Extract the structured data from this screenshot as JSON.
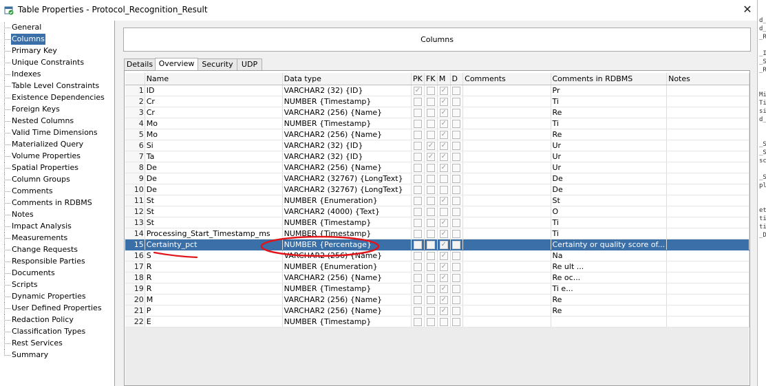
{
  "window": {
    "title": "Table Properties - Protocol_Recognition_Result",
    "close_glyph": "✕"
  },
  "nav": {
    "selected": "Columns",
    "items": [
      "General",
      "Columns",
      "Primary Key",
      "Unique Constraints",
      "Indexes",
      "Table Level Constraints",
      "Existence Dependencies",
      "Foreign Keys",
      "Nested Columns",
      "Valid Time Dimensions",
      "Materialized Query",
      "Volume Properties",
      "Spatial Properties",
      "Column Groups",
      "Comments",
      "Comments in RDBMS",
      "Notes",
      "Impact Analysis",
      "Measurements",
      "Change Requests",
      "Responsible Parties",
      "Documents",
      "Scripts",
      "Dynamic Properties",
      "User Defined Properties",
      "Redaction Policy",
      "Classification Types",
      "Rest Services",
      "Summary"
    ]
  },
  "section_title": "Columns",
  "tabs": [
    {
      "label": "Details",
      "active": false
    },
    {
      "label": "Overview",
      "active": true
    },
    {
      "label": "Security",
      "active": false
    },
    {
      "label": "UDP",
      "active": false
    }
  ],
  "grid": {
    "headers": {
      "name": "Name",
      "datatype": "Data type",
      "pk": "PK",
      "fk": "FK",
      "m": "M",
      "d": "D",
      "comments": "Comments",
      "comments_rdbms": "Comments in RDBMS",
      "notes": "Notes"
    },
    "selected_row": 15,
    "rows": [
      {
        "num": "1",
        "name": "ID",
        "datatype": "VARCHAR2 (32) {ID}",
        "pk": true,
        "fk": false,
        "m": true,
        "d": false,
        "comments": "",
        "rdbms": "Pr",
        "notes": ""
      },
      {
        "num": "2",
        "name": "Cr",
        "datatype": "NUMBER {Timestamp}",
        "pk": false,
        "fk": false,
        "m": true,
        "d": false,
        "comments": "",
        "rdbms": "Ti",
        "notes": ""
      },
      {
        "num": "3",
        "name": "Cr",
        "datatype": "VARCHAR2 (256) {Name}",
        "pk": false,
        "fk": false,
        "m": true,
        "d": false,
        "comments": "",
        "rdbms": "Re",
        "notes": ""
      },
      {
        "num": "4",
        "name": "Mo",
        "datatype": "NUMBER {Timestamp}",
        "pk": false,
        "fk": false,
        "m": true,
        "d": false,
        "comments": "",
        "rdbms": "Ti",
        "notes": ""
      },
      {
        "num": "5",
        "name": "Mo",
        "datatype": "VARCHAR2 (256) {Name}",
        "pk": false,
        "fk": false,
        "m": true,
        "d": false,
        "comments": "",
        "rdbms": "Re",
        "notes": ""
      },
      {
        "num": "6",
        "name": "Si",
        "datatype": "VARCHAR2 (32) {ID}",
        "pk": false,
        "fk": true,
        "m": true,
        "d": false,
        "comments": "",
        "rdbms": "Ur",
        "notes": ""
      },
      {
        "num": "7",
        "name": "Ta",
        "datatype": "VARCHAR2 (32) {ID}",
        "pk": false,
        "fk": true,
        "m": true,
        "d": false,
        "comments": "",
        "rdbms": "Ur",
        "notes": ""
      },
      {
        "num": "8",
        "name": "De",
        "datatype": "VARCHAR2 (256) {Name}",
        "pk": false,
        "fk": false,
        "m": true,
        "d": false,
        "comments": "",
        "rdbms": "Ur",
        "notes": ""
      },
      {
        "num": "9",
        "name": "De",
        "datatype": "VARCHAR2 (32767) {LongText}",
        "pk": false,
        "fk": false,
        "m": false,
        "d": false,
        "comments": "",
        "rdbms": "De",
        "notes": ""
      },
      {
        "num": "10",
        "name": "De",
        "datatype": "VARCHAR2 (32767) {LongText}",
        "pk": false,
        "fk": false,
        "m": false,
        "d": false,
        "comments": "",
        "rdbms": "De",
        "notes": ""
      },
      {
        "num": "11",
        "name": "St",
        "datatype": "NUMBER {Enumeration}",
        "pk": false,
        "fk": false,
        "m": true,
        "d": false,
        "comments": "",
        "rdbms": "St",
        "notes": ""
      },
      {
        "num": "12",
        "name": "St",
        "datatype": "VARCHAR2 (4000) {Text}",
        "pk": false,
        "fk": false,
        "m": false,
        "d": false,
        "comments": "",
        "rdbms": "O",
        "notes": ""
      },
      {
        "num": "13",
        "name": "St",
        "datatype": "NUMBER {Timestamp}",
        "pk": false,
        "fk": false,
        "m": true,
        "d": false,
        "comments": "",
        "rdbms": "Ti",
        "notes": ""
      },
      {
        "num": "14",
        "name": "Processing_Start_Timestamp_ms",
        "datatype": "NUMBER {Timestamp}",
        "pk": false,
        "fk": false,
        "m": true,
        "d": false,
        "comments": "",
        "rdbms": "Ti",
        "notes": ""
      },
      {
        "num": "15",
        "name": "Certainty_pct",
        "datatype": "NUMBER {Percentage}",
        "pk": false,
        "fk": false,
        "m": true,
        "d": false,
        "comments": "",
        "rdbms": "Certainty or quality score of...",
        "notes": ""
      },
      {
        "num": "16",
        "name": "S",
        "datatype": "VARCHAR2 (256) {Name}",
        "pk": false,
        "fk": false,
        "m": true,
        "d": false,
        "comments": "",
        "rdbms": "Na",
        "notes": ""
      },
      {
        "num": "17",
        "name": "R",
        "datatype": "NUMBER {Enumeration}",
        "pk": false,
        "fk": false,
        "m": true,
        "d": false,
        "comments": "",
        "rdbms": "Re                    ult ...",
        "notes": ""
      },
      {
        "num": "18",
        "name": "R",
        "datatype": "VARCHAR2 (256) {Name}",
        "pk": false,
        "fk": false,
        "m": true,
        "d": false,
        "comments": "",
        "rdbms": "Re                    oc...",
        "notes": ""
      },
      {
        "num": "19",
        "name": "R",
        "datatype": "NUMBER {Timestamp}",
        "pk": false,
        "fk": false,
        "m": true,
        "d": false,
        "comments": "",
        "rdbms": "Ti                     e...",
        "notes": ""
      },
      {
        "num": "20",
        "name": "M",
        "datatype": "VARCHAR2 (256) {Name}",
        "pk": false,
        "fk": false,
        "m": true,
        "d": false,
        "comments": "",
        "rdbms": "Re",
        "notes": ""
      },
      {
        "num": "21",
        "name": "P",
        "datatype": "VARCHAR2 (256) {Name}",
        "pk": false,
        "fk": false,
        "m": true,
        "d": false,
        "comments": "",
        "rdbms": "Re",
        "notes": ""
      },
      {
        "num": "22",
        "name": "E",
        "datatype": "NUMBER {Timestamp}",
        "pk": false,
        "fk": false,
        "m": false,
        "d": false,
        "comments": "",
        "rdbms": "",
        "notes": ""
      }
    ]
  },
  "bg_strip": [
    "",
    "",
    "d_",
    "d_",
    "_R",
    "",
    "_II",
    "_S",
    "_R",
    "",
    "",
    "Mi",
    "Ti",
    "sin",
    "d_",
    "",
    "",
    "_S",
    "_S",
    "sc",
    "",
    "_S",
    "pl",
    "",
    "",
    "et",
    "tin",
    "ti",
    "_D"
  ],
  "colors": {
    "selection": "#3b6fa8",
    "annotation": "#e0161b"
  }
}
